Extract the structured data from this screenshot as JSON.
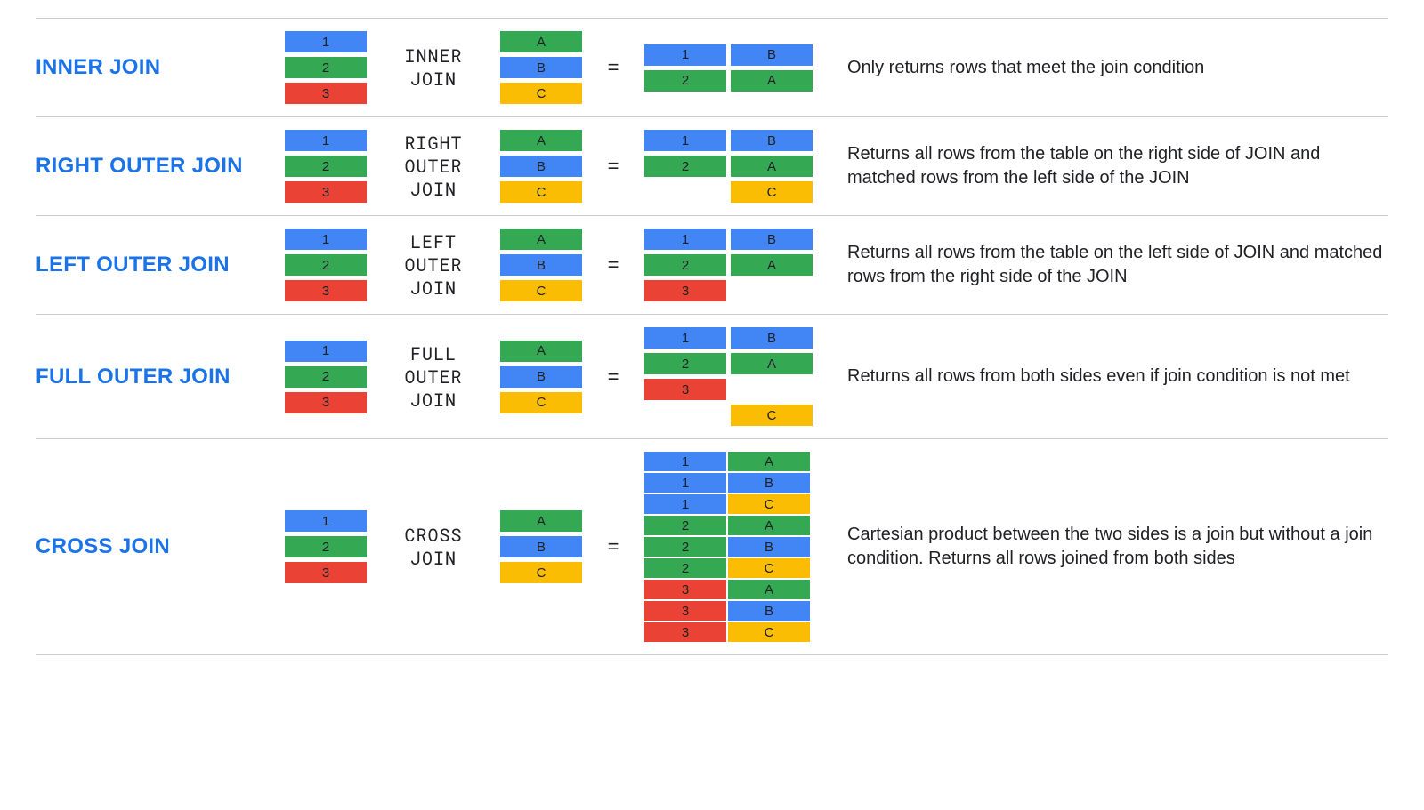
{
  "colors": {
    "blue": "#4285f4",
    "green": "#34a853",
    "red": "#ea4335",
    "yellow": "#fbbc04",
    "title": "#1a73e8"
  },
  "leftTable": [
    {
      "label": "1",
      "color": "blue"
    },
    {
      "label": "2",
      "color": "green"
    },
    {
      "label": "3",
      "color": "red"
    }
  ],
  "rightTable": [
    {
      "label": "A",
      "color": "green"
    },
    {
      "label": "B",
      "color": "blue"
    },
    {
      "label": "C",
      "color": "yellow"
    }
  ],
  "joins": [
    {
      "title": "INNER JOIN",
      "label": "INNER\nJOIN",
      "desc": "Only returns rows that meet the join condition",
      "result": [
        [
          {
            "label": "1",
            "color": "blue"
          },
          {
            "label": "B",
            "color": "blue"
          }
        ],
        [
          {
            "label": "2",
            "color": "green"
          },
          {
            "label": "A",
            "color": "green"
          }
        ]
      ],
      "compact": false
    },
    {
      "title": "RIGHT OUTER JOIN",
      "label": "RIGHT\nOUTER\nJOIN",
      "desc": "Returns all rows from the table on the right side of JOIN and matched rows from the left side of the JOIN",
      "result": [
        [
          {
            "label": "1",
            "color": "blue"
          },
          {
            "label": "B",
            "color": "blue"
          }
        ],
        [
          {
            "label": "2",
            "color": "green"
          },
          {
            "label": "A",
            "color": "green"
          }
        ],
        [
          null,
          {
            "label": "C",
            "color": "yellow"
          }
        ]
      ],
      "compact": false
    },
    {
      "title": "LEFT OUTER JOIN",
      "label": "LEFT\nOUTER\nJOIN",
      "desc": "Returns all rows from the table on the left side of JOIN and matched rows from the right side of the JOIN",
      "result": [
        [
          {
            "label": "1",
            "color": "blue"
          },
          {
            "label": "B",
            "color": "blue"
          }
        ],
        [
          {
            "label": "2",
            "color": "green"
          },
          {
            "label": "A",
            "color": "green"
          }
        ],
        [
          {
            "label": "3",
            "color": "red"
          },
          null
        ]
      ],
      "compact": false
    },
    {
      "title": "FULL OUTER JOIN",
      "label": "FULL\nOUTER\nJOIN",
      "desc": "Returns all rows from both sides even if join condition is not met",
      "result": [
        [
          {
            "label": "1",
            "color": "blue"
          },
          {
            "label": "B",
            "color": "blue"
          }
        ],
        [
          {
            "label": "2",
            "color": "green"
          },
          {
            "label": "A",
            "color": "green"
          }
        ],
        [
          {
            "label": "3",
            "color": "red"
          },
          null
        ],
        [
          null,
          {
            "label": "C",
            "color": "yellow"
          }
        ]
      ],
      "compact": false
    },
    {
      "title": "CROSS JOIN",
      "label": "CROSS\nJOIN",
      "desc": "Cartesian product between the two sides is a join but without a join condition. Returns all rows joined from both sides",
      "result": [
        [
          {
            "label": "1",
            "color": "blue"
          },
          {
            "label": "A",
            "color": "green"
          }
        ],
        [
          {
            "label": "1",
            "color": "blue"
          },
          {
            "label": "B",
            "color": "blue"
          }
        ],
        [
          {
            "label": "1",
            "color": "blue"
          },
          {
            "label": "C",
            "color": "yellow"
          }
        ],
        [
          {
            "label": "2",
            "color": "green"
          },
          {
            "label": "A",
            "color": "green"
          }
        ],
        [
          {
            "label": "2",
            "color": "green"
          },
          {
            "label": "B",
            "color": "blue"
          }
        ],
        [
          {
            "label": "2",
            "color": "green"
          },
          {
            "label": "C",
            "color": "yellow"
          }
        ],
        [
          {
            "label": "3",
            "color": "red"
          },
          {
            "label": "A",
            "color": "green"
          }
        ],
        [
          {
            "label": "3",
            "color": "red"
          },
          {
            "label": "B",
            "color": "blue"
          }
        ],
        [
          {
            "label": "3",
            "color": "red"
          },
          {
            "label": "C",
            "color": "yellow"
          }
        ]
      ],
      "compact": true
    }
  ]
}
